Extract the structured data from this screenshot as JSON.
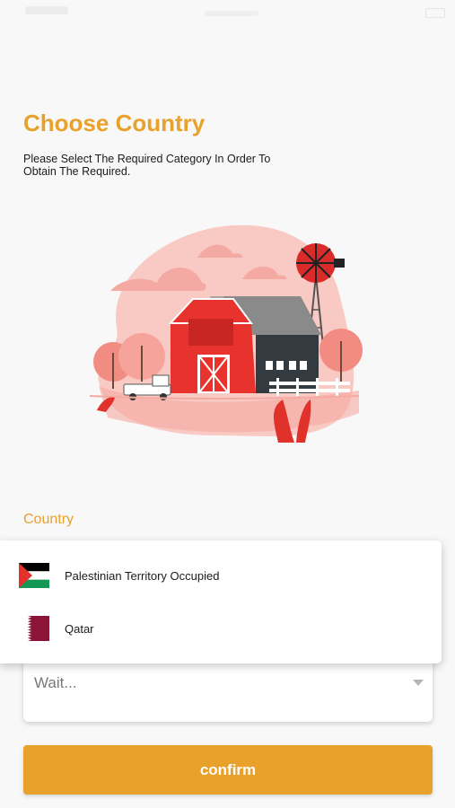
{
  "header": {
    "title": "Choose Country",
    "subtitle": "Please Select The Required Category In Order To Obtain The Required."
  },
  "form": {
    "country_label": "Country",
    "select_value": "Wait...",
    "options": [
      {
        "label": "Palestinian Territory Occupied",
        "flag": "palestine-flag-icon"
      },
      {
        "label": "Qatar",
        "flag": "qatar-flag-icon"
      }
    ],
    "confirm_label": "confirm"
  },
  "colors": {
    "accent": "#e8a12a",
    "background": "#f8f8f8",
    "barn_red": "#e8322d"
  }
}
